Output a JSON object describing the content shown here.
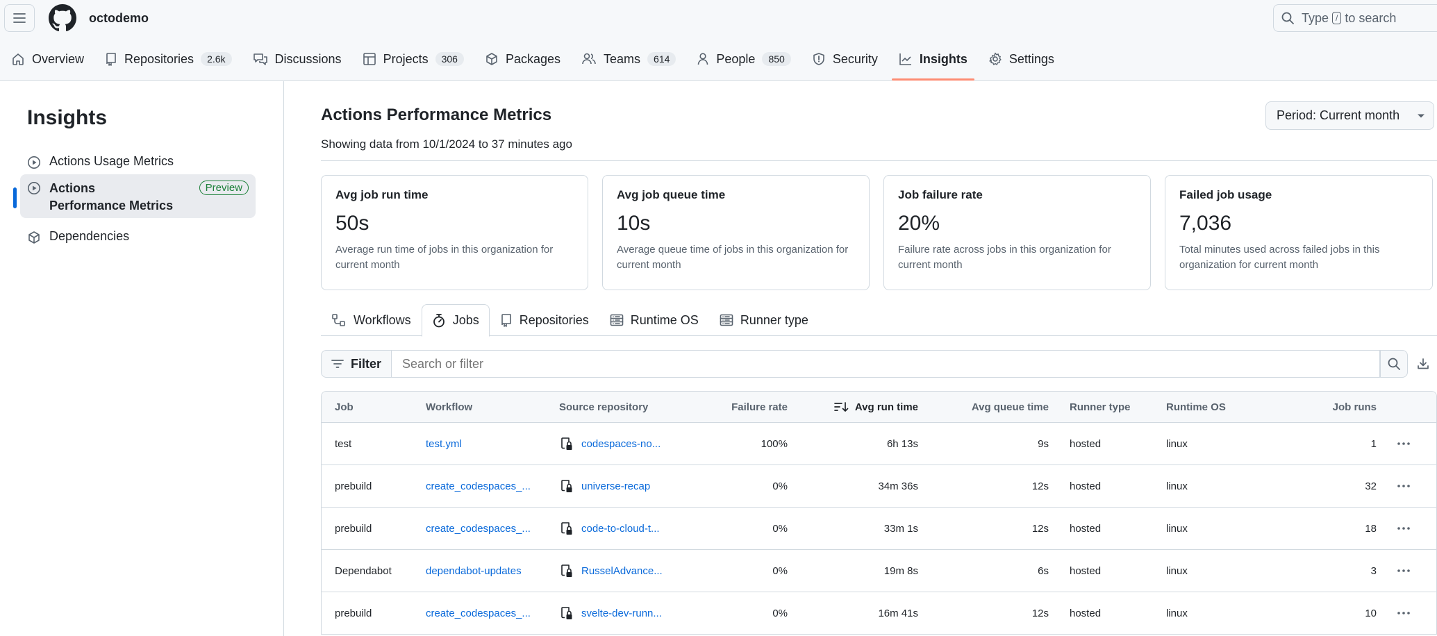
{
  "header": {
    "org_name": "octodemo",
    "search": {
      "prefix": "Type",
      "key": "/",
      "suffix": "to search"
    },
    "nav": [
      {
        "label": "Overview",
        "icon": "home-icon",
        "counter": null,
        "active": false
      },
      {
        "label": "Repositories",
        "icon": "repo-icon",
        "counter": "2.6k",
        "active": false
      },
      {
        "label": "Discussions",
        "icon": "comment-discussion-icon",
        "counter": null,
        "active": false
      },
      {
        "label": "Projects",
        "icon": "table-icon",
        "counter": "306",
        "active": false
      },
      {
        "label": "Packages",
        "icon": "package-icon",
        "counter": null,
        "active": false
      },
      {
        "label": "Teams",
        "icon": "people-icon",
        "counter": "614",
        "active": false
      },
      {
        "label": "People",
        "icon": "person-icon",
        "counter": "850",
        "active": false
      },
      {
        "label": "Security",
        "icon": "shield-icon",
        "counter": null,
        "active": false
      },
      {
        "label": "Insights",
        "icon": "graph-icon",
        "counter": null,
        "active": true
      },
      {
        "label": "Settings",
        "icon": "gear-icon",
        "counter": null,
        "active": false
      }
    ]
  },
  "sidebar": {
    "title": "Insights",
    "items": [
      {
        "label": "Actions Usage Metrics",
        "icon": "play-icon",
        "active": false,
        "badge": null
      },
      {
        "label": "Actions Performance Metrics",
        "icon": "play-icon",
        "active": true,
        "badge": "Preview"
      },
      {
        "label": "Dependencies",
        "icon": "package-icon",
        "active": false,
        "badge": null
      }
    ]
  },
  "main": {
    "title": "Actions Performance Metrics",
    "subtitle": "Showing data from 10/1/2024 to 37 minutes ago",
    "period_button": "Period: Current month",
    "cards": [
      {
        "title": "Avg job run time",
        "value": "50s",
        "description": "Average run time of jobs in this organization for current month"
      },
      {
        "title": "Avg job queue time",
        "value": "10s",
        "description": "Average queue time of jobs in this organization for current month"
      },
      {
        "title": "Job failure rate",
        "value": "20%",
        "description": "Failure rate across jobs in this organization for current month"
      },
      {
        "title": "Failed job usage",
        "value": "7,036",
        "description": "Total minutes used across failed jobs in this organization for current month"
      }
    ],
    "tabs": [
      {
        "label": "Workflows",
        "icon": "workflow-icon",
        "active": false
      },
      {
        "label": "Jobs",
        "icon": "stopwatch-icon",
        "active": true
      },
      {
        "label": "Repositories",
        "icon": "repo-icon",
        "active": false
      },
      {
        "label": "Runtime OS",
        "icon": "server-icon",
        "active": false
      },
      {
        "label": "Runner type",
        "icon": "server-icon",
        "active": false
      }
    ],
    "filter": {
      "button_label": "Filter",
      "placeholder": "Search or filter",
      "value": ""
    },
    "table": {
      "columns": [
        "Job",
        "Workflow",
        "Source repository",
        "Failure rate",
        "Avg run time",
        "Avg queue time",
        "Runner type",
        "Runtime OS",
        "Job runs"
      ],
      "sorted_column": "Avg run time",
      "rows": [
        {
          "job": "test",
          "workflow": "test.yml",
          "repo": "codespaces-no...",
          "failure_rate": "100%",
          "avg_run": "6h 13s",
          "avg_queue": "9s",
          "runner": "hosted",
          "os": "linux",
          "runs": "1"
        },
        {
          "job": "prebuild",
          "workflow": "create_codespaces_...",
          "repo": "universe-recap",
          "failure_rate": "0%",
          "avg_run": "34m 36s",
          "avg_queue": "12s",
          "runner": "hosted",
          "os": "linux",
          "runs": "32"
        },
        {
          "job": "prebuild",
          "workflow": "create_codespaces_...",
          "repo": "code-to-cloud-t...",
          "failure_rate": "0%",
          "avg_run": "33m 1s",
          "avg_queue": "12s",
          "runner": "hosted",
          "os": "linux",
          "runs": "18"
        },
        {
          "job": "Dependabot",
          "workflow": "dependabot-updates",
          "repo": "RusselAdvance...",
          "failure_rate": "0%",
          "avg_run": "19m 8s",
          "avg_queue": "6s",
          "runner": "hosted",
          "os": "linux",
          "runs": "3"
        },
        {
          "job": "prebuild",
          "workflow": "create_codespaces_...",
          "repo": "svelte-dev-runn...",
          "failure_rate": "0%",
          "avg_run": "16m 41s",
          "avg_queue": "12s",
          "runner": "hosted",
          "os": "linux",
          "runs": "10"
        }
      ]
    }
  },
  "colors": {
    "accent_underline": "#fd8c73",
    "link": "#0969da",
    "active_bar": "#0969da",
    "preview_badge": "#1a7f37"
  }
}
